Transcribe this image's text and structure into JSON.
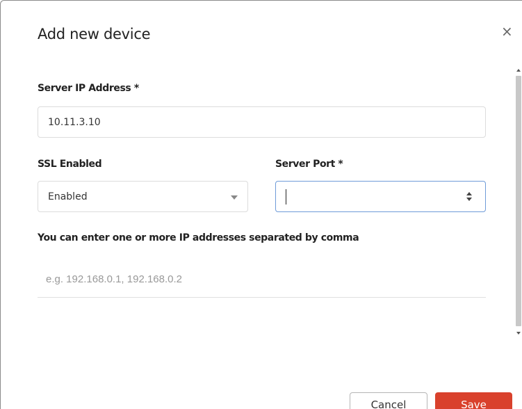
{
  "dialog": {
    "title": "Add new device",
    "close_glyph": "×"
  },
  "fields": {
    "server_ip": {
      "label": "Server IP Address *",
      "value": "10.11.3.10"
    },
    "ssl_enabled": {
      "label": "SSL Enabled",
      "selected": "Enabled"
    },
    "server_port": {
      "label": "Server Port *",
      "value": ""
    },
    "ip_list": {
      "label": "You can enter one or more IP addresses separated by comma",
      "placeholder": "e.g. 192.168.0.1, 192.168.0.2"
    }
  },
  "buttons": {
    "cancel": "Cancel",
    "save": "Save"
  },
  "colors": {
    "save_bg": "#d9412c",
    "focus_border": "#6e9bd8"
  },
  "icons": {
    "close": "close-icon",
    "select": "chevron-down-icon",
    "spinner": "spinner-icon"
  }
}
